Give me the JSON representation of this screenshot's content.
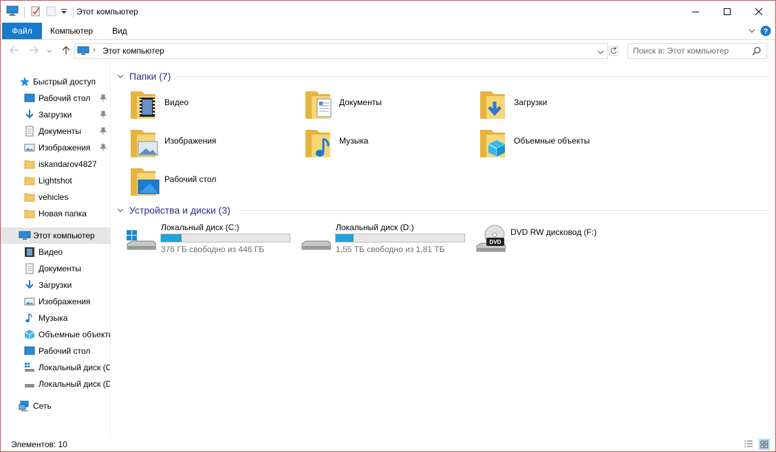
{
  "window": {
    "title": "Этот компьютер"
  },
  "ribbon": {
    "tabs": [
      "Файл",
      "Компьютер",
      "Вид"
    ]
  },
  "address": {
    "path": "Этот компьютер",
    "search_placeholder": "Поиск в: Этот компьютер"
  },
  "nav": {
    "quick_access": "Быстрый доступ",
    "quick_items": [
      "Рабочий стол",
      "Загрузки",
      "Документы",
      "Изображения",
      "iskandarov4827",
      "Lightshot",
      "vehicles",
      "Новая папка"
    ],
    "this_pc": "Этот компьютер",
    "pc_items": [
      "Видео",
      "Документы",
      "Загрузки",
      "Изображения",
      "Музыка",
      "Объемные объекты",
      "Рабочий стол",
      "Локальный диск (C",
      "Локальный диск (D"
    ],
    "network": "Сеть"
  },
  "folders": {
    "header": "Папки (7)",
    "items": [
      "Видео",
      "Документы",
      "Загрузки",
      "Изображения",
      "Музыка",
      "Объемные объекты",
      "Рабочий стол"
    ]
  },
  "devices": {
    "header": "Устройства и диски (3)",
    "items": [
      {
        "name": "Локальный диск (C:)",
        "free": "376 ГБ свободно из 446 ГБ",
        "used_fraction": 0.16
      },
      {
        "name": "Локальный диск (D:)",
        "free": "1,55 ТБ свободно из 1,81 ТБ",
        "used_fraction": 0.14
      },
      {
        "name": "DVD RW дисковод (F:)"
      }
    ]
  },
  "status": {
    "count": "Элементов: 10"
  },
  "colors": {
    "accent": "#1979ca",
    "header_text": "#1e3287",
    "bar_fill": "#26a0da",
    "folder": "#f3c864"
  }
}
